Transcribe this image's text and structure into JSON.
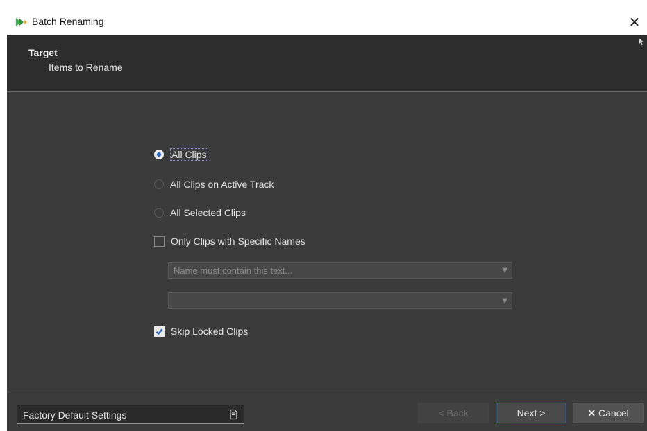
{
  "window": {
    "title": "Batch Renaming",
    "close_glyph": "✕"
  },
  "header": {
    "title": "Target",
    "subtitle": "Items to Rename"
  },
  "options": {
    "all_clips": "All Clips",
    "active_track": "All Clips on Active Track",
    "selected_clips": "All Selected Clips",
    "specific_names": "Only Clips with Specific Names",
    "skip_locked": "Skip Locked Clips"
  },
  "state": {
    "selected_radio": "All Clips",
    "specific_names_checked": false,
    "skip_locked_checked": true
  },
  "filters": {
    "name_placeholder": "Name must contain this text...",
    "second_value": ""
  },
  "footer": {
    "preset_label": "Factory Default Settings",
    "back_label": "< Back",
    "next_label": "Next >",
    "cancel_label": "Cancel",
    "cancel_glyph": "✕"
  },
  "colors": {
    "accent": "#3c7fc8",
    "background": "#3b3b3b",
    "header_bg": "#2d2d2d",
    "radio_dot": "#1f5fbf"
  }
}
